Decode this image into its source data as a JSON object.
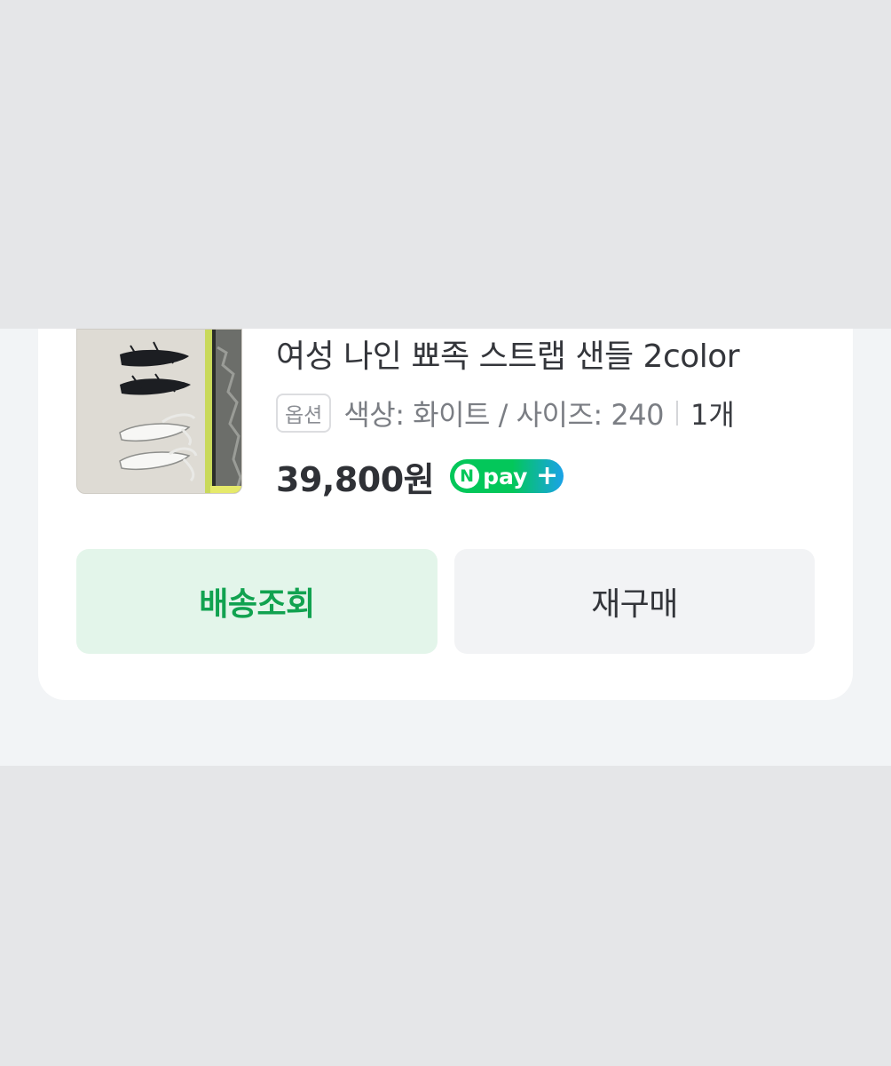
{
  "order_item": {
    "product_image_icon": "sandals-product-photo-icon",
    "title": "여성 나인 뾰족 스트랩 샌들 2color",
    "option_badge": "옵션",
    "option_text": "색상: 화이트 / 사이즈: 240",
    "quantity": "1개",
    "price": "39,800원",
    "pay_badge": {
      "n_letter": "N",
      "word": "pay",
      "plus": "+"
    }
  },
  "actions": {
    "track_label": "배송조회",
    "reorder_label": "재구매"
  },
  "colors": {
    "page_background": "#e5e6e8",
    "band_background": "#f2f4f6",
    "card_background": "#ffffff",
    "track_button_background": "#e3f5ea",
    "track_button_text": "#11a250",
    "reorder_button_background": "#f2f3f5",
    "npay_green": "#03c75a",
    "npay_blue": "#1aa2e8"
  }
}
